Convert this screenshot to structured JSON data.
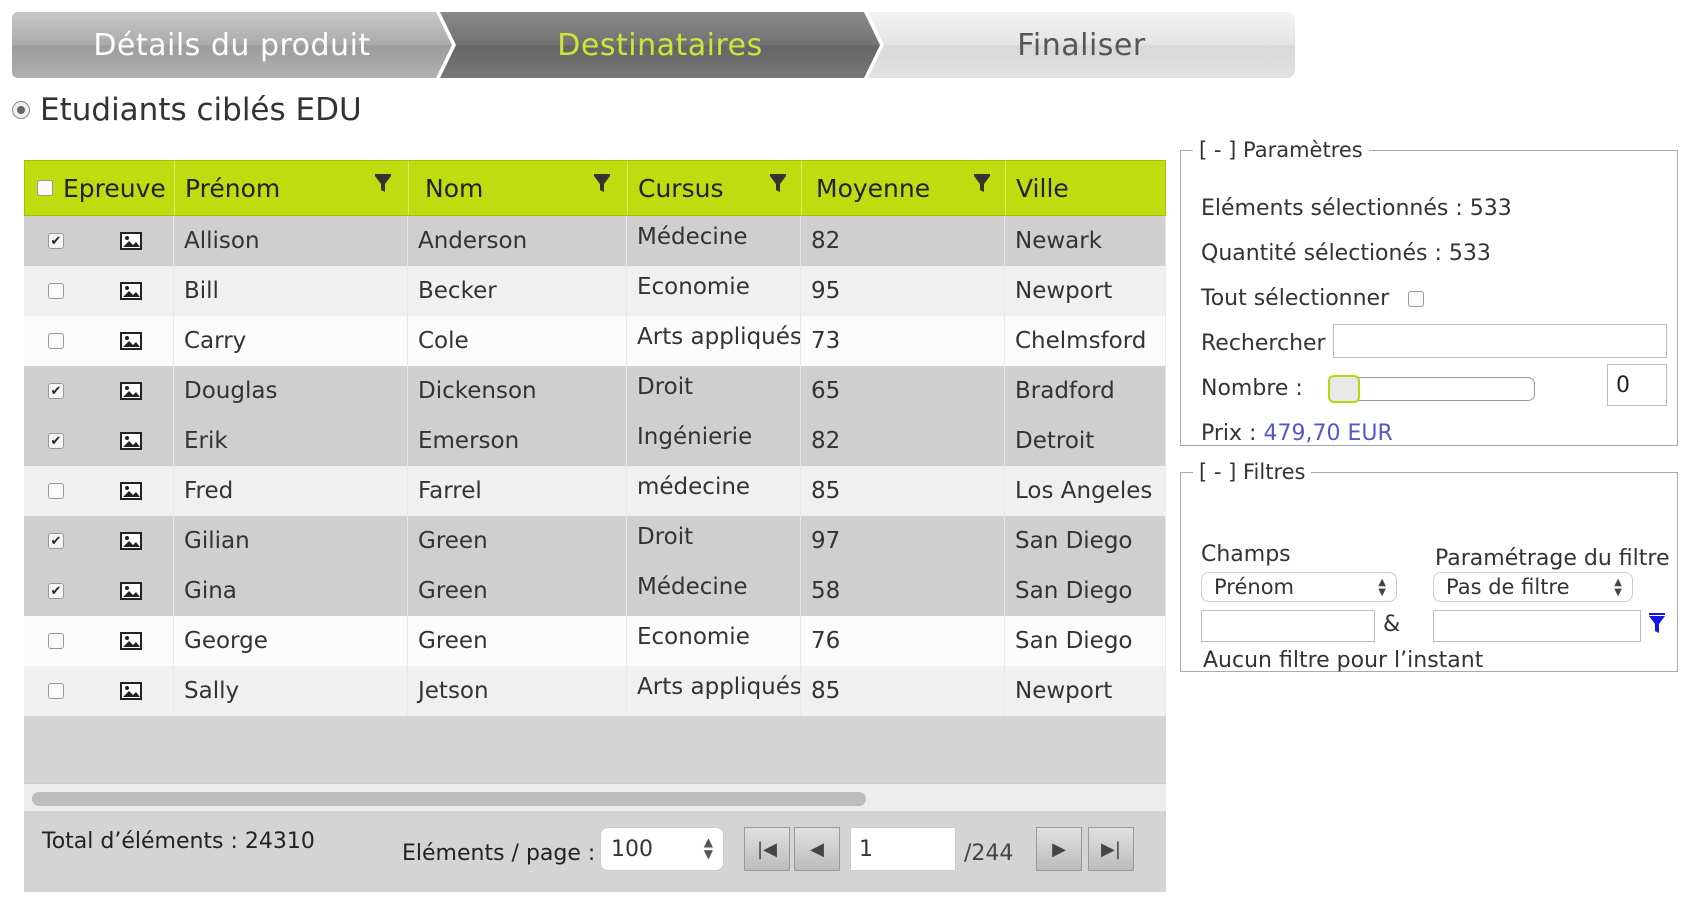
{
  "wizard": {
    "steps": [
      {
        "label": "Détails du produit"
      },
      {
        "label": "Destinataires"
      },
      {
        "label": "Finaliser"
      }
    ]
  },
  "section": {
    "title": "Etudiants ciblés EDU"
  },
  "grid": {
    "columns": {
      "epreuve": "Epreuve",
      "prenom": "Prénom",
      "nom": "Nom",
      "cursus": "Cursus",
      "moyenne": "Moyenne",
      "ville": "Ville"
    },
    "rows": [
      {
        "checked": "✔",
        "prenom": "Allison",
        "nom": "Anderson",
        "cursus": "Médecine",
        "moyenne": "82",
        "ville": "Newark"
      },
      {
        "checked": "",
        "prenom": "Bill",
        "nom": "Becker",
        "cursus": "Economie",
        "moyenne": "95",
        "ville": "Newport"
      },
      {
        "checked": "",
        "prenom": "Carry",
        "nom": "Cole",
        "cursus": "Arts appliqués",
        "moyenne": "73",
        "ville": "Chelmsford"
      },
      {
        "checked": "✔",
        "prenom": "Douglas",
        "nom": "Dickenson",
        "cursus": "Droit",
        "moyenne": "65",
        "ville": "Bradford"
      },
      {
        "checked": "✔",
        "prenom": "Erik",
        "nom": "Emerson",
        "cursus": "Ingénierie",
        "moyenne": "82",
        "ville": "Detroit"
      },
      {
        "checked": "",
        "prenom": "Fred",
        "nom": "Farrel",
        "cursus": "médecine",
        "moyenne": "85",
        "ville": "Los Angeles"
      },
      {
        "checked": "✔",
        "prenom": "Gilian",
        "nom": "Green",
        "cursus": "Droit",
        "moyenne": "97",
        "ville": "San Diego"
      },
      {
        "checked": "✔",
        "prenom": "Gina",
        "nom": "Green",
        "cursus": "Médecine",
        "moyenne": "58",
        "ville": "San Diego"
      },
      {
        "checked": "",
        "prenom": "George",
        "nom": "Green",
        "cursus": "Economie",
        "moyenne": "76",
        "ville": "San Diego"
      },
      {
        "checked": "",
        "prenom": "Sally",
        "nom": "Jetson",
        "cursus": "Arts appliqués",
        "moyenne": "85",
        "ville": "Newport"
      }
    ],
    "footer": {
      "total_label": "Total d’éléments : 24310",
      "per_page_label": "Eléments  /  page :",
      "per_page_value": "100",
      "page_value": "1",
      "page_total": "/244"
    }
  },
  "parametres": {
    "legend": "[ - ] Paramètres",
    "selected_elements": "Eléments sélectionnés : 533",
    "selected_quantity": "Quantité sélectionés : 533",
    "select_all_label": "Tout sélectionner",
    "search_label": "Rechercher",
    "search_value": "",
    "number_label": "Nombre :",
    "number_value": "0",
    "price_label": "Prix :",
    "price_value": "479,70 EUR"
  },
  "filtres": {
    "legend": "[ - ] Filtres",
    "champs_label": "Champs",
    "filter_param_label": "Paramétrage du filtre",
    "champs_value": "Prénom",
    "filter_value": "Pas de filtre",
    "ampersand": "&",
    "empty_message": "Aucun filtre pour l’instant"
  },
  "colors": {
    "accent": "#bedc0f",
    "active_step_text": "#cfe43a",
    "price": "#5555cc"
  },
  "icons": {
    "filter": "funnel-icon",
    "row_image": "image-icon",
    "pager_first": "first-page-icon",
    "pager_prev": "prev-page-icon",
    "pager_next": "next-page-icon",
    "pager_last": "last-page-icon"
  }
}
